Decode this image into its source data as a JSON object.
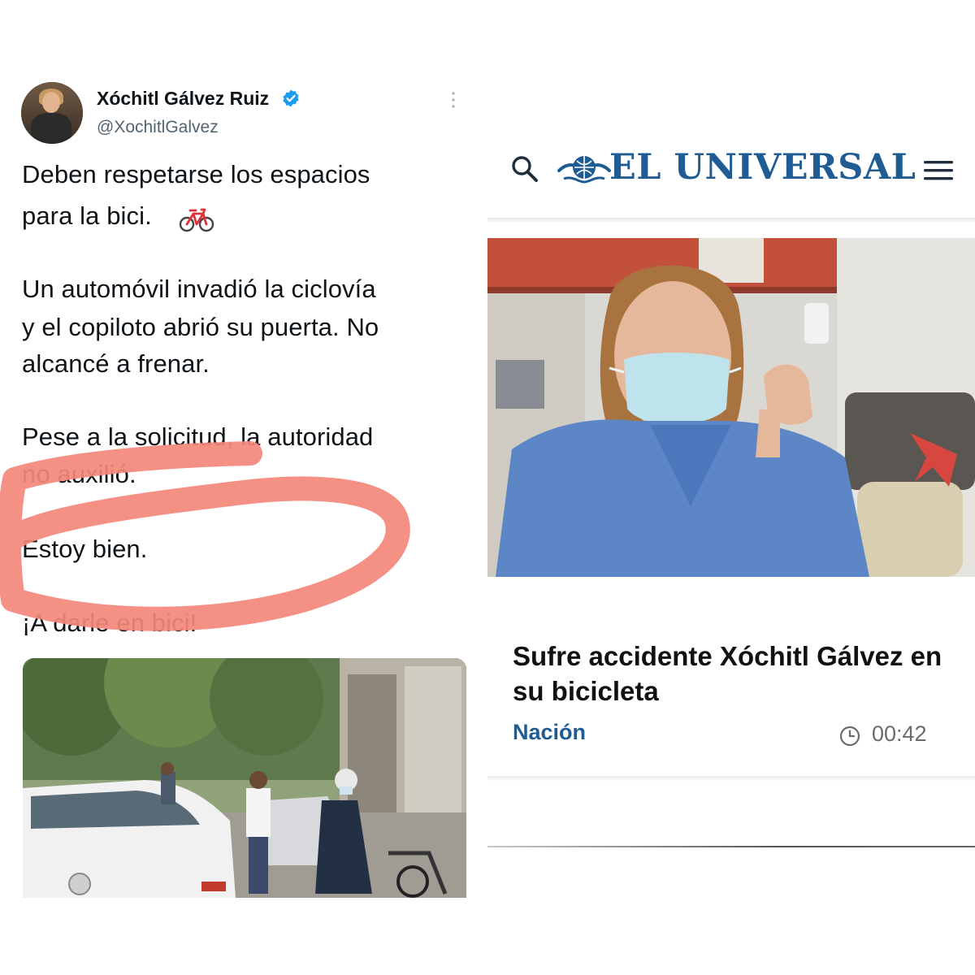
{
  "tweet": {
    "display_name": "Xóchitl Gálvez Ruiz",
    "handle": "@XochitlGalvez",
    "lines": [
      "Deben respetarse los espacios",
      "para la bici.",
      "Un automóvil invadió la ciclovía",
      "y el copiloto abrió su puerta. No",
      "alcancé a frenar.",
      "Pese a la solicitud, la autoridad",
      "no auxilió.",
      "Estoy bien.",
      "¡A darle en bici!"
    ],
    "emoji": "bicycle-icon",
    "highlight_color": "#f4877b",
    "verified_color": "#1d9bf0"
  },
  "article": {
    "brand": "EL UNIVERSAL",
    "headline": "Sufre accidente Xóchitl Gálvez en su bicicleta",
    "section": "Nación",
    "duration": "00:42",
    "brand_color": "#1f5c93"
  }
}
